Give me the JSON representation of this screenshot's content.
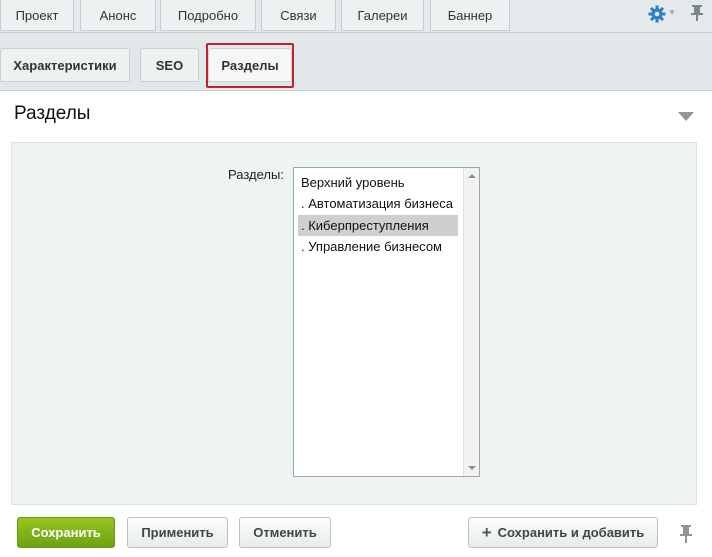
{
  "top_tabs": [
    "Проект",
    "Анонс",
    "Подробно",
    "Связи",
    "Галереи",
    "Баннер"
  ],
  "sub_tabs": [
    "Характеристики",
    "SEO",
    "Разделы"
  ],
  "active_sub_tab": "Разделы",
  "section": {
    "title": "Разделы"
  },
  "form": {
    "field_label": "Разделы:",
    "options": [
      "Верхний уровень",
      ". Автоматизация бизнеса",
      ". Киберпреступления",
      ". Управление бизнесом"
    ],
    "selected_option": ". Киберпреступления"
  },
  "buttons": {
    "save": "Сохранить",
    "apply": "Применить",
    "cancel": "Отменить",
    "save_and_add": "Сохранить и добавить"
  },
  "icons": [
    "gear-icon",
    "dropdown-arrow-icon",
    "pin-icon",
    "collapse-arrow-icon",
    "plus-icon"
  ],
  "colors": {
    "accent_green": "#7fb21a",
    "highlight_red": "#c0232b",
    "gear_blue": "#2e7fc4"
  }
}
